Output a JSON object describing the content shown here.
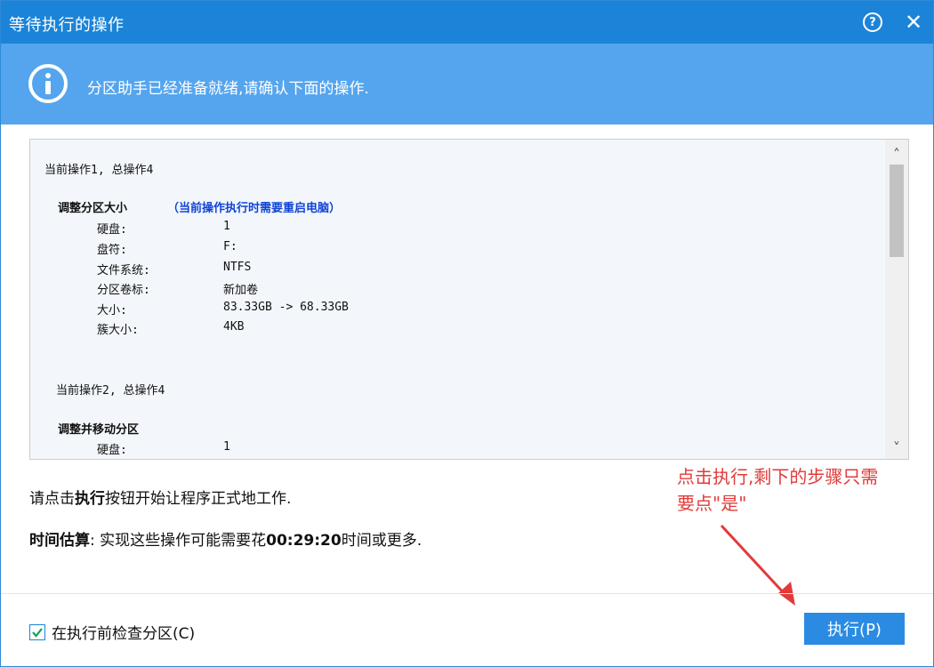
{
  "window": {
    "title": "等待执行的操作",
    "help_icon": "help-circle-icon",
    "help_symbol": "?",
    "close_icon": "close-icon",
    "close_symbol": "✕"
  },
  "banner": {
    "icon": "info-circle-icon",
    "text": "分区助手已经准备就绪,请确认下面的操作."
  },
  "operations": [
    {
      "header": "当前操作1, 总操作4",
      "name": "调整分区大小",
      "note": "（当前操作执行时需要重启电脑）",
      "details": [
        {
          "label": "硬盘:",
          "value": "1"
        },
        {
          "label": "盘符:",
          "value": "F:"
        },
        {
          "label": "文件系统:",
          "value": "NTFS"
        },
        {
          "label": "分区卷标:",
          "value": "新加卷"
        },
        {
          "label": "大小:",
          "value": "83.33GB -> 68.33GB"
        },
        {
          "label": "簇大小:",
          "value": "4KB"
        }
      ]
    },
    {
      "header": "当前操作2, 总操作4",
      "name": "调整并移动分区",
      "details": [
        {
          "label": "硬盘:",
          "value": "1"
        }
      ]
    }
  ],
  "scrollbar": {
    "up_icon": "chevron-up-icon",
    "up_symbol": "˄",
    "down_icon": "chevron-down-icon",
    "down_symbol": "˅"
  },
  "prompt": {
    "prefix": "请点击",
    "bold": "执行",
    "suffix": "按钮开始让程序正式地工作."
  },
  "estimate": {
    "label": "时间估算",
    "text_before": ": 实现这些操作可能需要花",
    "time": "00:29:20",
    "text_after": "时间或更多."
  },
  "annotation": {
    "line1": "点击执行,剩下的步骤只需",
    "line2": "要点\"是\"",
    "color": "#e23a3a"
  },
  "footer": {
    "checkbox_checked": true,
    "checkbox_label": "在执行前检查分区(C)",
    "execute_label": "执行(P)"
  },
  "colors": {
    "titlebar": "#1b84d8",
    "banner": "#55a5ee",
    "button": "#2b8be3"
  }
}
